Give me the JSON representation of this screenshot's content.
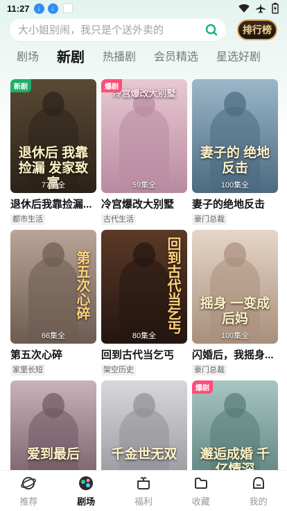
{
  "status_bar": {
    "time": "11:27"
  },
  "search": {
    "placeholder": "大小姐别闹，我只是个送外卖的",
    "rank_label": "排行榜"
  },
  "tabs": [
    {
      "label": "剧场",
      "active": false
    },
    {
      "label": "新剧",
      "active": true
    },
    {
      "label": "热播剧",
      "active": false
    },
    {
      "label": "会员精选",
      "active": false
    },
    {
      "label": "星选好剧",
      "active": false
    }
  ],
  "cards": [
    {
      "title": "退休后我靠捡漏...",
      "tag": "都市生活",
      "episodes": "77集全",
      "badge": "新剧",
      "poster_text": "退休后 我靠捡漏 发家致富",
      "colors": [
        "#5a4a36",
        "#2b2218"
      ]
    },
    {
      "title": "冷宫爆改大别墅",
      "tag": "古代生活",
      "episodes": "59集全",
      "badge": "爆剧",
      "poster_text": "冷宫爆改大别墅",
      "colors": [
        "#e8c9d2",
        "#b88aa0"
      ]
    },
    {
      "title": "妻子的绝地反击",
      "tag": "豪门总裁",
      "episodes": "100集全",
      "badge": "",
      "poster_text": "妻子的 绝地反击",
      "colors": [
        "#9bb7c9",
        "#4c6a80"
      ]
    },
    {
      "title": "第五次心碎",
      "tag": "家里长短",
      "episodes": "66集全",
      "badge": "",
      "poster_text": "第五次心碎",
      "colors": [
        "#b9a497",
        "#6d5b51"
      ]
    },
    {
      "title": "回到古代当乞丐",
      "tag": "架空历史",
      "episodes": "80集全",
      "badge": "",
      "poster_text": "回到古代当乞丐",
      "colors": [
        "#5b3a26",
        "#241510"
      ]
    },
    {
      "title": "闪婚后，我摇身...",
      "tag": "豪门总裁",
      "episodes": "100集全",
      "badge": "",
      "poster_text": "摇身 一变成后妈",
      "colors": [
        "#e6d6c8",
        "#a98f7c"
      ]
    },
    {
      "title": "",
      "tag": "",
      "episodes": "",
      "badge": "",
      "poster_text": "爱到最后",
      "colors": [
        "#c9b2b9",
        "#6f5560"
      ]
    },
    {
      "title": "",
      "tag": "",
      "episodes": "",
      "badge": "",
      "poster_text": "千金世无双",
      "colors": [
        "#d8d8dc",
        "#8f9096"
      ]
    },
    {
      "title": "",
      "tag": "",
      "episodes": "",
      "badge": "爆剧",
      "poster_text": "邂逅成婚 千亿情深",
      "colors": [
        "#a8c6c2",
        "#557a76"
      ]
    }
  ],
  "bottom_nav": [
    {
      "label": "推荐",
      "icon": "planet-icon",
      "active": false
    },
    {
      "label": "剧场",
      "icon": "theater-icon",
      "active": true
    },
    {
      "label": "福利",
      "icon": "gift-icon",
      "active": false
    },
    {
      "label": "收藏",
      "icon": "folder-icon",
      "active": false
    },
    {
      "label": "我的",
      "icon": "profile-icon",
      "active": false
    }
  ],
  "colors": {
    "accent_green": "#1fae6a",
    "hot_pink": "#ff4d79",
    "rank_gold": "#d8a75a"
  }
}
